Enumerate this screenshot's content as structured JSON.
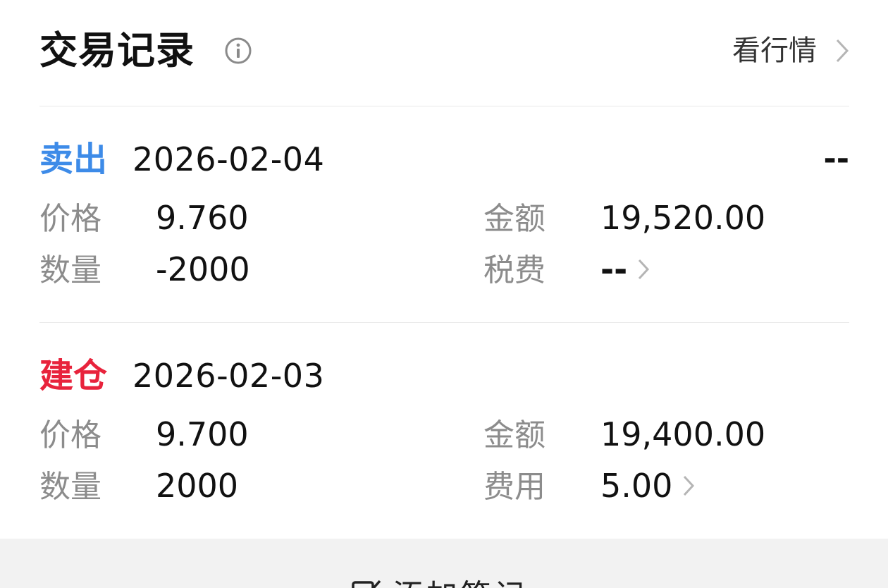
{
  "header": {
    "title": "交易记录",
    "info_icon": "info-circle-icon",
    "market_link_label": "看行情",
    "market_link_icon": "chevron-right-icon"
  },
  "records": [
    {
      "type": "卖出",
      "type_color": "#3d8be8",
      "date": "2026-02-04",
      "right_value": "--",
      "price_label": "价格",
      "price": "9.760",
      "amount_label": "金额",
      "amount": "19,520.00",
      "quantity_label": "数量",
      "quantity": "-2000",
      "fee_label": "税费",
      "fee": "--"
    },
    {
      "type": "建仓",
      "type_color": "#e8233c",
      "date": "2026-02-03",
      "right_value": "",
      "price_label": "价格",
      "price": "9.700",
      "amount_label": "金额",
      "amount": "19,400.00",
      "quantity_label": "数量",
      "quantity": "2000",
      "fee_label": "费用",
      "fee": "5.00"
    }
  ],
  "footer": {
    "label": "添加笔记",
    "icon": "edit-note-icon"
  },
  "colors": {
    "label_gray": "#8c8c8c",
    "divider": "#e9e9e9",
    "footer_bg": "#f2f2f2"
  }
}
